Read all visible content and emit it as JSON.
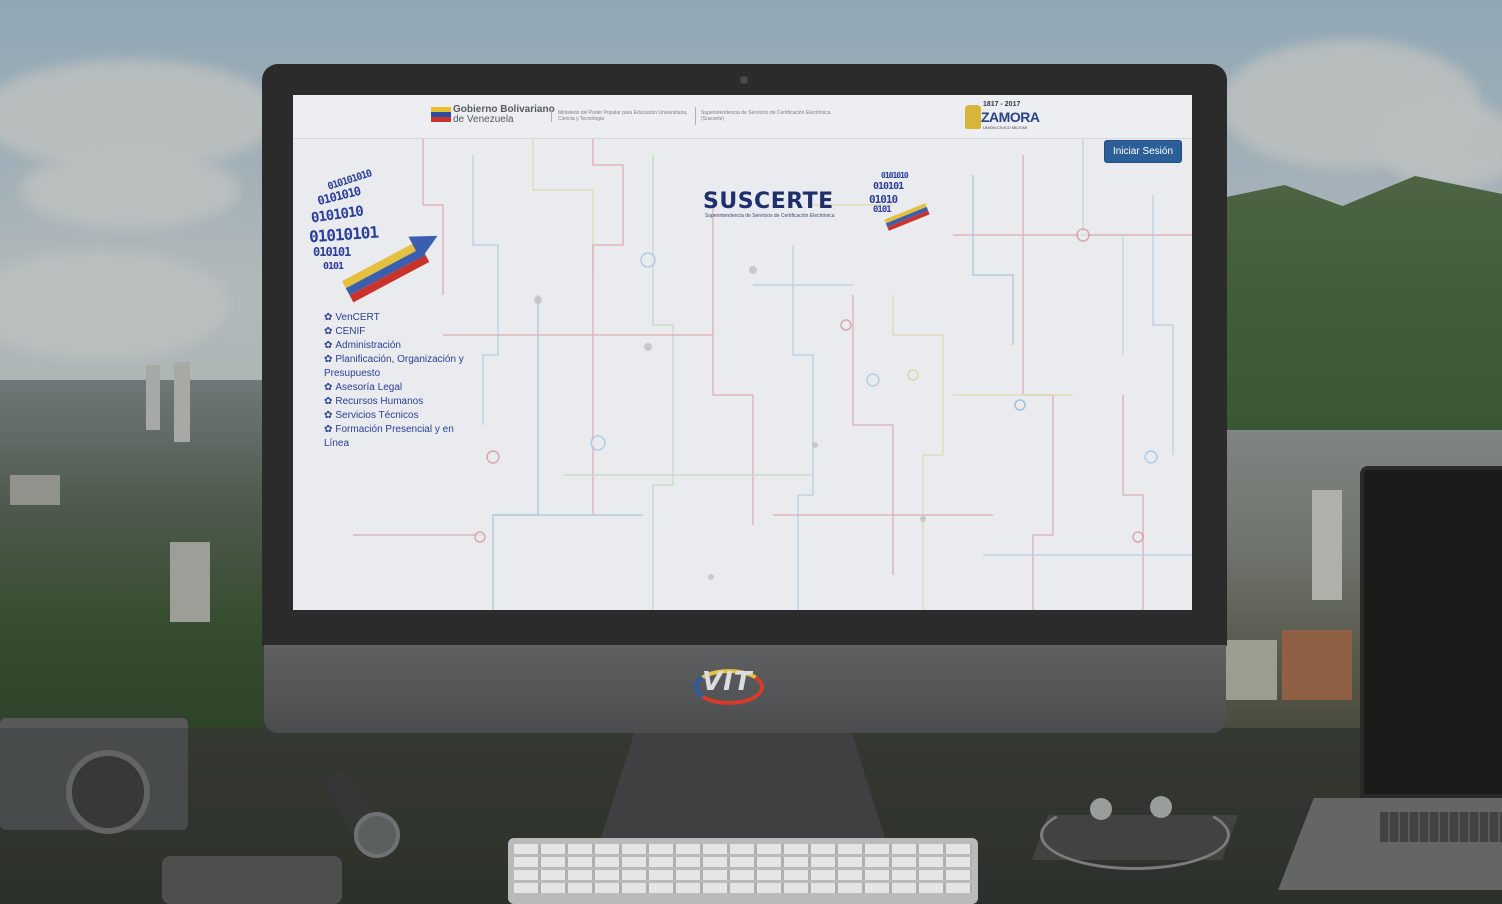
{
  "header": {
    "gov_name_bold": "Gobierno Bolivariano",
    "gov_name_rest": "de Venezuela",
    "ministry": "Ministerio del Poder Popular para Educación Universitaria, Ciencia y Tecnología",
    "superintendencia": "Superintendencia de Servicios de Certificación Electrónica (Suscerte)",
    "zamora_years": "1817 - 2017",
    "zamora_name": "ZAMORA",
    "zamora_sub": "UNIÓN CÍVICO MILITAR"
  },
  "login_button": "Iniciar Sesión",
  "brand": {
    "name": "SUSCERTE",
    "tagline": "Superintendencia de Servicios de Certificación Electrónica"
  },
  "nav": {
    "items": [
      {
        "label": "VenCERT"
      },
      {
        "label": "CENIF"
      },
      {
        "label": "Administración"
      },
      {
        "label": "Planificación, Organización y Presupuesto"
      },
      {
        "label": "Asesoría Legal"
      },
      {
        "label": "Recursos Humanos"
      },
      {
        "label": "Servicios Técnicos"
      },
      {
        "label": "Formación Presencial y en Línea"
      }
    ]
  },
  "monitor_logo": "VIT",
  "colors": {
    "button": "#2c5f98",
    "link": "#2c3f92",
    "brand_text": "#1f2f6b"
  },
  "icons": {
    "nav_bullet": "gear-icon"
  }
}
